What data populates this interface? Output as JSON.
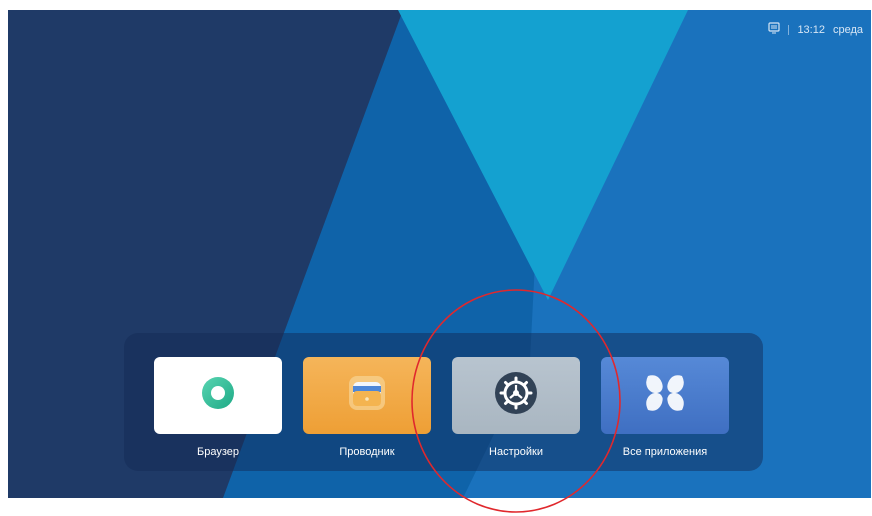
{
  "status_bar": {
    "icon": "tv-input-icon",
    "time": "13:12",
    "day": "среда"
  },
  "dock": {
    "apps": [
      {
        "label": "Браузер",
        "icon": "browser-icon",
        "tile_color": "#ffffff"
      },
      {
        "label": "Проводник",
        "icon": "folder-icon",
        "tile_color": "#f2aa45"
      },
      {
        "label": "Настройки",
        "icon": "settings-gear-icon",
        "tile_color": "#adb9c4"
      },
      {
        "label": "Все приложения",
        "icon": "all-apps-icon",
        "tile_color": "#4a7dcc"
      }
    ]
  },
  "colors": {
    "background_dark": "#1f3a67",
    "background_mid": "#0f63a9",
    "background_light": "#14a1d0",
    "annotation_ring": "#e0282d"
  }
}
